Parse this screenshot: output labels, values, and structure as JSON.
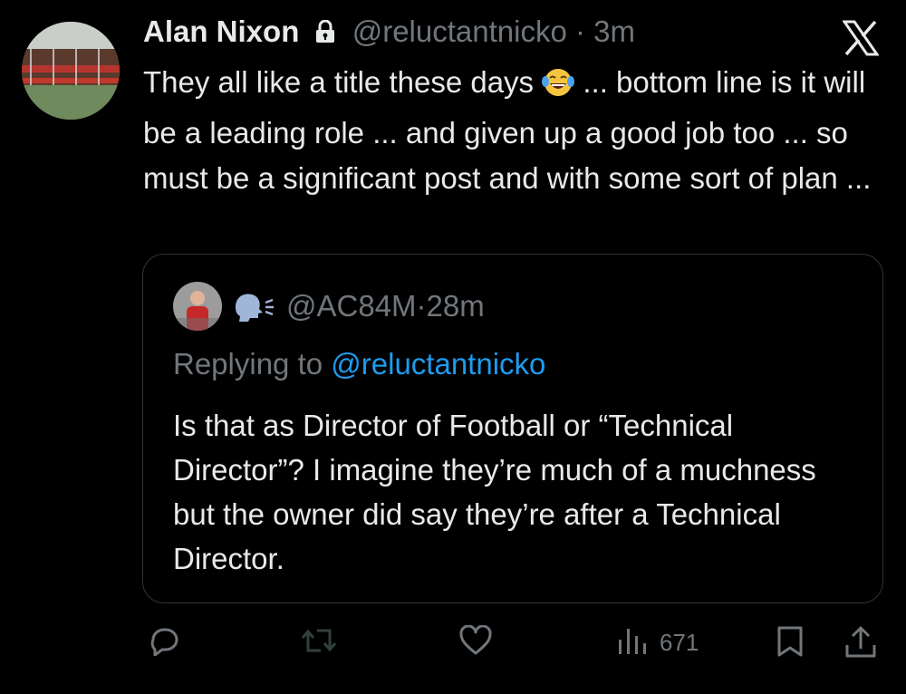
{
  "tweet": {
    "author_name": "Alan Nixon",
    "handle": "@reluctantnicko",
    "separator": "·",
    "time": "3m",
    "text_before_emoji": "They all like a title these days",
    "text_after_emoji": " ... bottom line is it will be a leading role ... and given up a good job too ... so must be a significant post and with some sort of plan ..."
  },
  "quoted": {
    "handle": "@AC84M",
    "separator": "·",
    "time": "28m",
    "replying_to_label": "Replying to",
    "replying_to_handle": "@reluctantnicko",
    "text": "Is that as Director of Football or “Technical Director”? I imagine they’re much of a muchness but the owner did say they’re after a Technical Director."
  },
  "actions": {
    "views": "671"
  },
  "icons": [
    "lock-icon",
    "x-logo-icon",
    "laughing-emoji",
    "speaking-head-icon",
    "reply-icon",
    "retweet-icon",
    "like-icon",
    "views-icon",
    "bookmark-icon",
    "share-icon"
  ],
  "colors": {
    "background": "#000000",
    "text": "#e7e9ea",
    "secondary": "#71767b",
    "link": "#1d9bf0",
    "border": "#2f3336"
  }
}
